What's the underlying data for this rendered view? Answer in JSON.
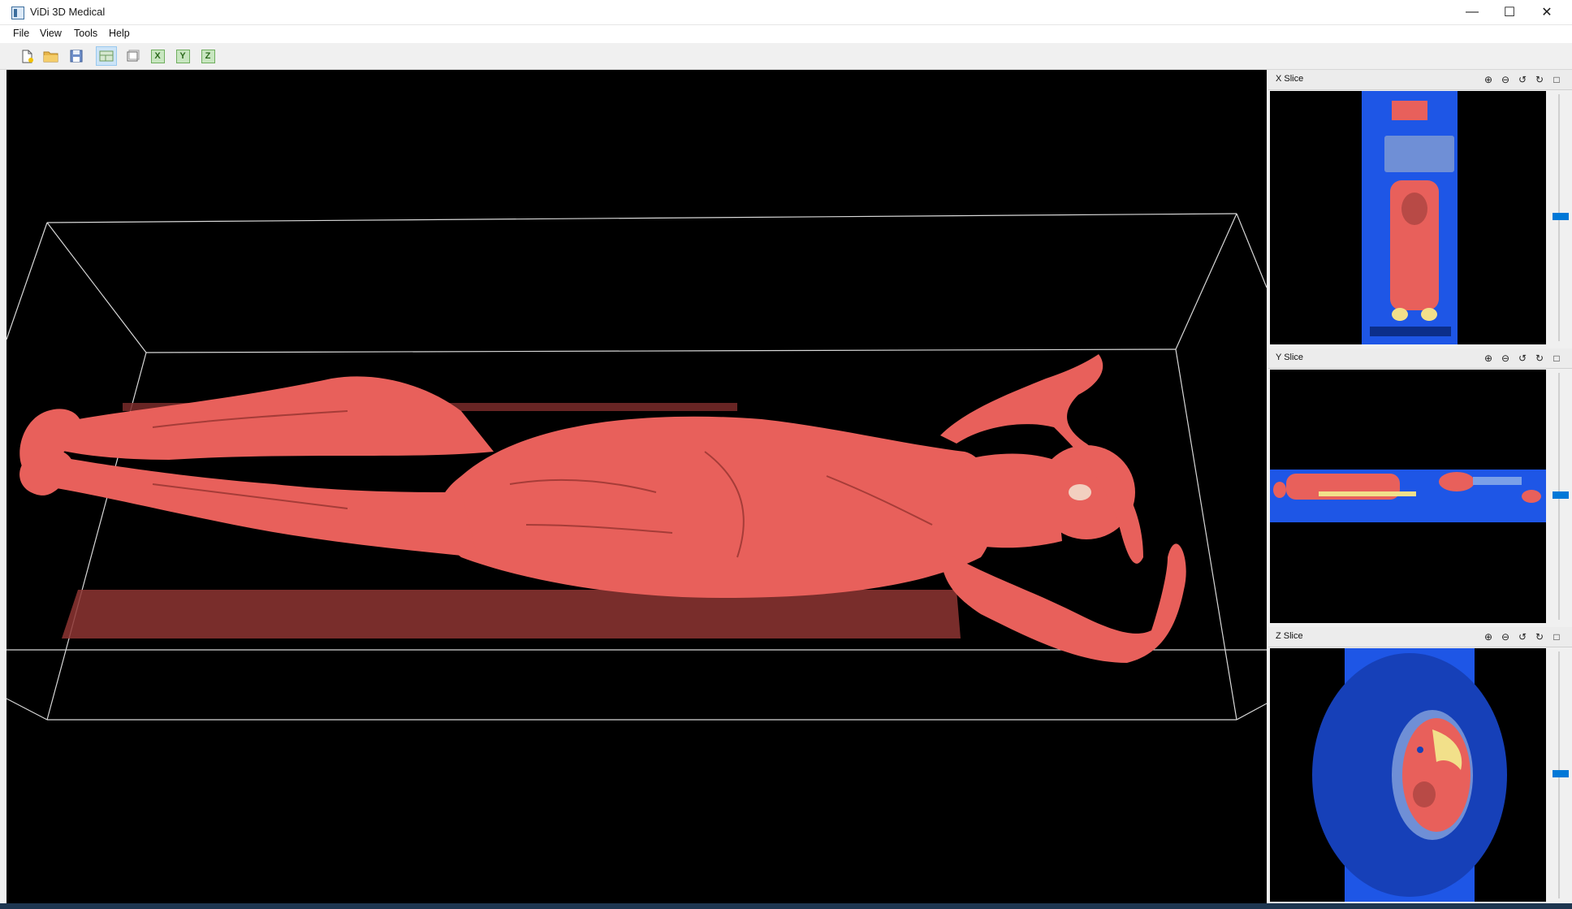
{
  "window": {
    "title": "ViDi 3D Medical",
    "minimize": "—",
    "maximize": "☐",
    "close": "✕"
  },
  "menu": [
    "File",
    "View",
    "Tools",
    "Help"
  ],
  "toolbar": {
    "new_icon": "new-file-icon",
    "open_icon": "open-folder-icon",
    "save_icon": "save-icon",
    "layout_icon": "layout-grid-icon",
    "single_icon": "single-view-icon",
    "x_label": "X",
    "y_label": "Y",
    "z_label": "Z"
  },
  "viewport": {
    "render": "3D volume rendering of body",
    "tissue_color": "#e8605b"
  },
  "slices": [
    {
      "title": "X Slice",
      "level": 0.48
    },
    {
      "title": "Y Slice",
      "level": 0.48
    },
    {
      "title": "Z Slice",
      "level": 0.48
    }
  ],
  "slice_icons": [
    "zoom-in-icon",
    "zoom-out-icon",
    "rotate-left-icon",
    "rotate-right-icon",
    "maximize-icon"
  ],
  "colors": {
    "accent": "#0078d7",
    "tissue": "#e8605b",
    "scan_blue": "#1e56e6",
    "bone": "#f2e08a"
  }
}
